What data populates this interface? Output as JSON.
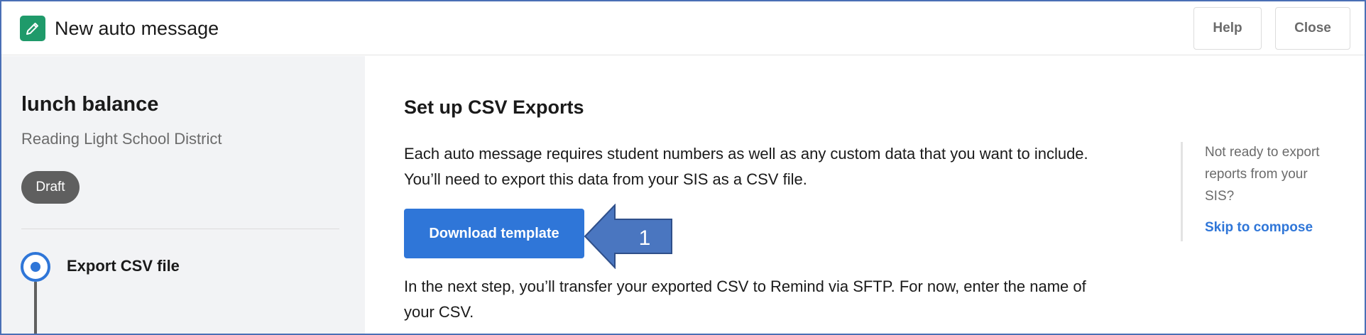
{
  "header": {
    "icon": "pencil-icon",
    "title": "New auto message",
    "help_label": "Help",
    "close_label": "Close"
  },
  "sidebar": {
    "title": "lunch balance",
    "subtitle": "Reading Light School District",
    "status_badge": "Draft",
    "steps": [
      {
        "label": "Export CSV file",
        "state": "active"
      }
    ]
  },
  "main": {
    "title": "Set up CSV Exports",
    "intro_line1": "Each auto message requires student numbers as well as any custom data that you want to include.",
    "intro_line2": "You’ll need to export this data from your SIS as a CSV file.",
    "download_button": "Download template",
    "callout_number": "1",
    "next_step_line1": "In the next step, you’ll transfer your exported CSV to Remind via SFTP. For now, enter the name of",
    "next_step_line2": "your CSV."
  },
  "aside": {
    "note_line1": "Not ready to export",
    "note_line2": "reports from your",
    "note_line3": "SIS?",
    "skip_link": "Skip to compose"
  },
  "colors": {
    "accent": "#2f76d8",
    "brand_icon_bg": "#1f9a6a",
    "badge_bg": "#5f5f5f",
    "sidebar_bg": "#f2f3f5",
    "callout_fill": "#4a76c0",
    "frame_border": "#4a6fb5"
  }
}
